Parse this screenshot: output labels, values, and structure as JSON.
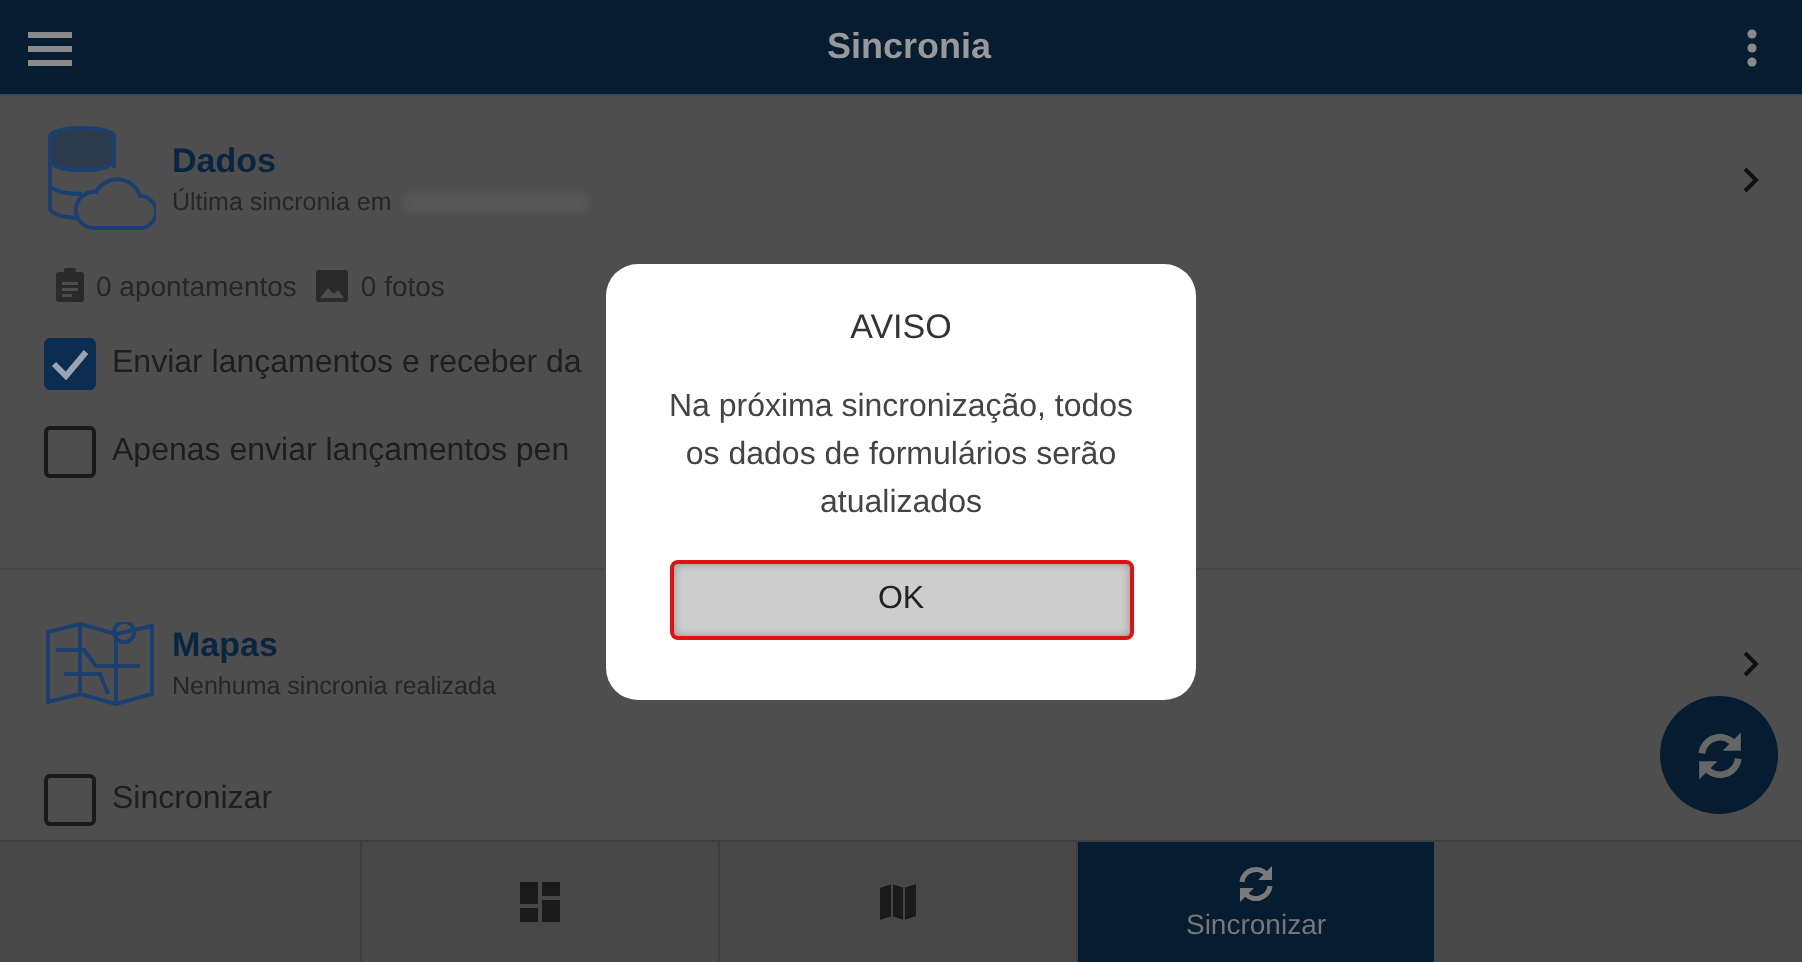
{
  "app_bar": {
    "title": "Sincronia"
  },
  "sections": [
    {
      "title": "Dados",
      "kind": "data",
      "subtitle": "Última sincronia em",
      "counts": [
        {
          "kind": "clipboard",
          "text": "0 apontamentos"
        },
        {
          "kind": "image",
          "text": "0 fotos"
        }
      ],
      "options": [
        {
          "label": "Enviar lançamentos e receber da",
          "checked": true
        },
        {
          "label": "Apenas enviar lançamentos pen",
          "checked": false
        }
      ]
    },
    {
      "title": "Mapas",
      "kind": "maps",
      "subtitle": "Nenhuma sincronia realizada",
      "options": [
        {
          "label": "Sincronizar",
          "checked": false
        }
      ]
    }
  ],
  "bottom_nav": [
    {
      "kind": "dashboard",
      "selected": false
    },
    {
      "kind": "map",
      "selected": false
    },
    {
      "kind": "sync",
      "label": "Sincronizar",
      "selected": true
    }
  ],
  "dialog": {
    "title": "AVISO",
    "message": "Na próxima sincronização, todos os dados de formulários serão atualizados",
    "button": "OK"
  }
}
